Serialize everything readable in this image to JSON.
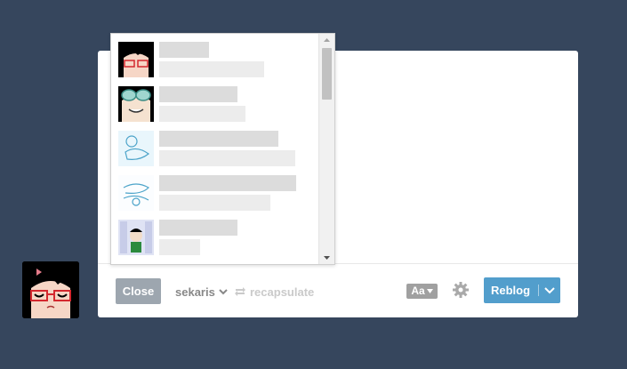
{
  "footer": {
    "close_label": "Close",
    "blog_name": "sekaris",
    "reblog_source": "recapsulate",
    "text_style_label": "Aa",
    "reblog_label": "Reblog"
  },
  "mention_dropdown": {
    "item_count": 5,
    "items": [
      {
        "thumb": "avatar-girl-glasses"
      },
      {
        "thumb": "avatar-goggles"
      },
      {
        "thumb": "avatar-sketch-figure"
      },
      {
        "thumb": "avatar-sketch-lettering"
      },
      {
        "thumb": "avatar-character-collage"
      }
    ]
  },
  "colors": {
    "background": "#36465d",
    "reblog_button": "#529ecc",
    "close_button": "#9da6af"
  }
}
